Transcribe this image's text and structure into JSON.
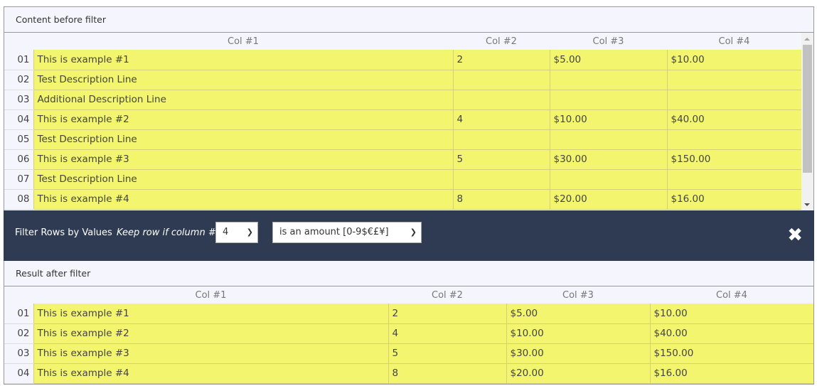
{
  "before": {
    "title": "Content before filter",
    "headers": [
      "Col #1",
      "Col #2",
      "Col #3",
      "Col #4"
    ],
    "rows": [
      [
        "01",
        "This is example #1",
        "2",
        "$5.00",
        "$10.00"
      ],
      [
        "02",
        "Test Description Line",
        "",
        "",
        ""
      ],
      [
        "03",
        "Additional Description Line",
        "",
        "",
        ""
      ],
      [
        "04",
        "This is example #2",
        "4",
        "$10.00",
        "$40.00"
      ],
      [
        "05",
        "Test Description Line",
        "",
        "",
        ""
      ],
      [
        "06",
        "This is example #3",
        "5",
        "$30.00",
        "$150.00"
      ],
      [
        "07",
        "Test Description Line",
        "",
        "",
        ""
      ],
      [
        "08",
        "This is example #4",
        "8",
        "$20.00",
        "$16.00"
      ]
    ]
  },
  "filter": {
    "title": "Filter Rows by Values",
    "keep_label": "Keep row if column #",
    "column_value": "4",
    "condition_value": "is an amount [0-9$€£¥]"
  },
  "after": {
    "title": "Result after filter",
    "headers": [
      "Col #1",
      "Col #2",
      "Col #3",
      "Col #4"
    ],
    "rows": [
      [
        "01",
        "This is example #1",
        "2",
        "$5.00",
        "$10.00"
      ],
      [
        "02",
        "This is example #2",
        "4",
        "$10.00",
        "$40.00"
      ],
      [
        "03",
        "This is example #3",
        "5",
        "$30.00",
        "$150.00"
      ],
      [
        "04",
        "This is example #4",
        "8",
        "$20.00",
        "$16.00"
      ]
    ]
  }
}
